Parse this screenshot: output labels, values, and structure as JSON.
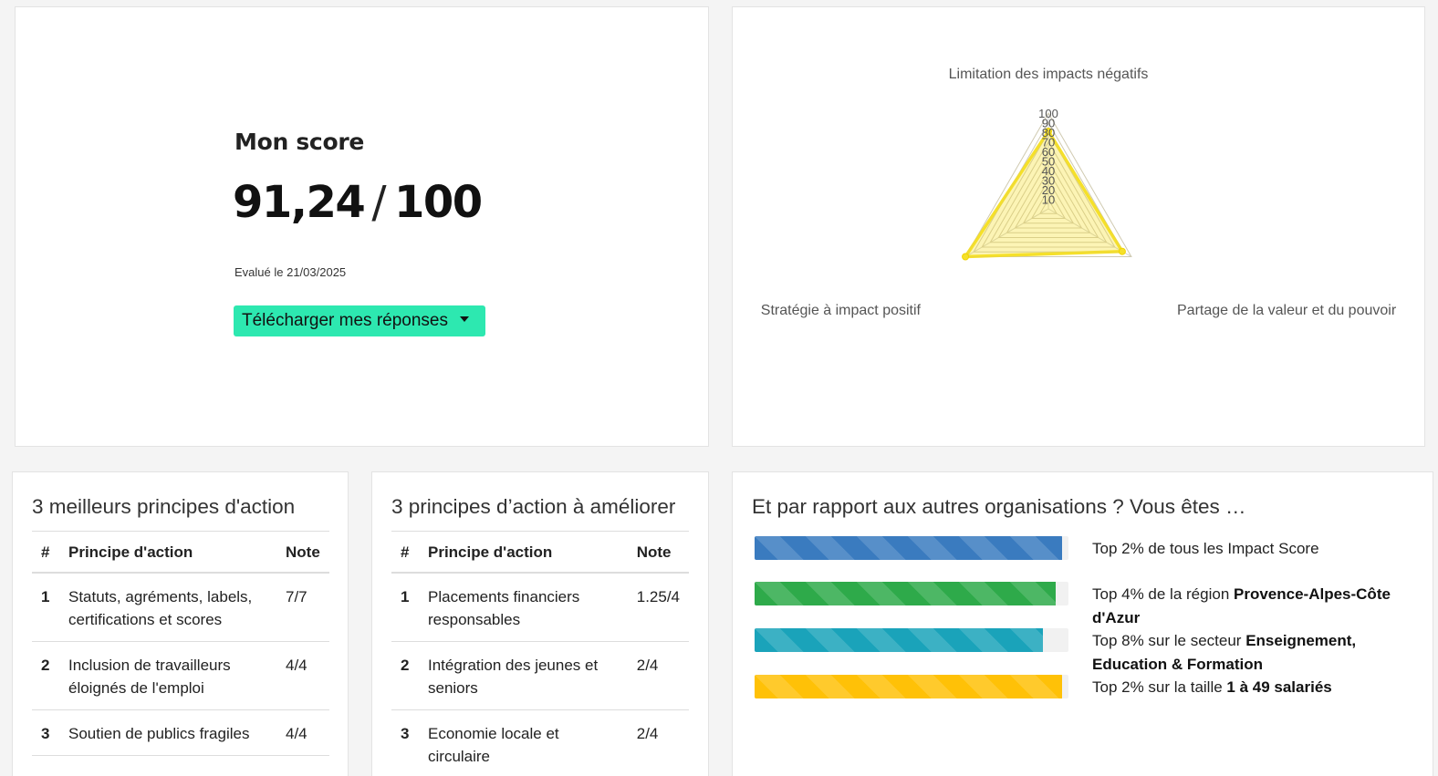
{
  "score": {
    "title": "Mon score",
    "value": "91,24",
    "max": "100",
    "separator": "/",
    "evaluated": "Evalué le 21/03/2025",
    "download_label": "Télécharger mes réponses",
    "button_color": "#2de8b0"
  },
  "chart_data": {
    "type": "radar",
    "axes": [
      "Limitation des impacts négatifs",
      "Partage de la valeur et du pouvoir",
      "Stratégie à impact positif"
    ],
    "values": [
      81,
      89,
      100
    ],
    "rmin": 0,
    "rmax": 100,
    "ticks": [
      "10",
      "20",
      "30",
      "40",
      "50",
      "60",
      "70",
      "80",
      "90",
      "100"
    ],
    "series_color": "#f5e02a"
  },
  "best": {
    "title": "3 meilleurs principes d'action",
    "headers": [
      "#",
      "Principe d'action",
      "Note"
    ],
    "rows": [
      {
        "rank": "1",
        "name": "Statuts, agréments, labels, certifications et scores",
        "note": "7/7"
      },
      {
        "rank": "2",
        "name": "Inclusion de travailleurs éloignés de l'emploi",
        "note": "4/4"
      },
      {
        "rank": "3",
        "name": "Soutien de publics fragiles",
        "note": "4/4"
      }
    ]
  },
  "improve": {
    "title": "3 principes d’action à améliorer",
    "headers": [
      "#",
      "Principe d'action",
      "Note"
    ],
    "rows": [
      {
        "rank": "1",
        "name": "Placements financiers responsables",
        "note": "1.25/4"
      },
      {
        "rank": "2",
        "name": "Intégration des jeunes et seniors",
        "note": "2/4"
      },
      {
        "rank": "3",
        "name": "Economie locale et circulaire",
        "note": "2/4"
      }
    ]
  },
  "compare": {
    "title": "Et par rapport aux autres organisations ? Vous êtes …",
    "bars": [
      {
        "fill": 0.98,
        "color": "#3a7bbf",
        "prefix": "Top 2% de tous les Impact Score",
        "bold": ""
      },
      {
        "fill": 0.96,
        "color": "#2eaa4a",
        "prefix": "Top 4% de la région ",
        "bold": "Provence-Alpes-Côte d'Azur"
      },
      {
        "fill": 0.92,
        "color": "#1aa3ba",
        "prefix": "Top 8% sur le secteur ",
        "bold": "Enseignement, Education & Formation"
      },
      {
        "fill": 0.98,
        "color": "#ffc107",
        "prefix": "Top 2% sur la taille ",
        "bold": "1 à 49 salariés"
      }
    ]
  }
}
